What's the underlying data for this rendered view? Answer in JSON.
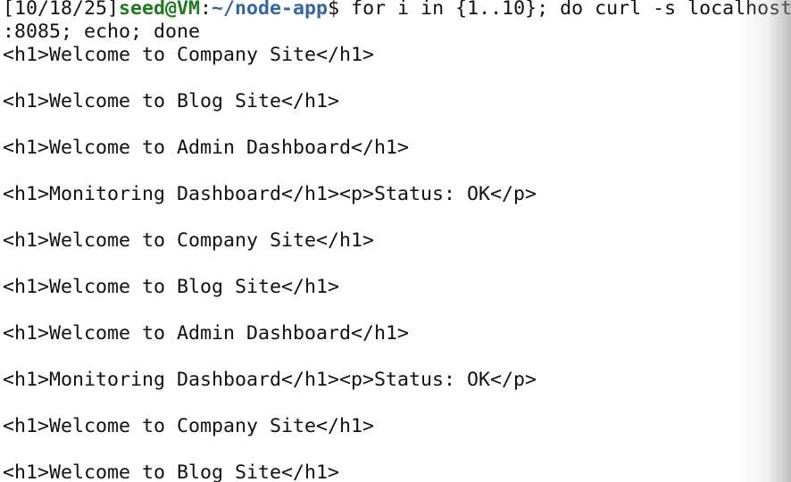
{
  "prompt": {
    "timestamp": "[10/18/25]",
    "user_host": "seed@VM",
    "separator": ":",
    "path": "~/node-app",
    "symbol": "$",
    "command": " for i in {1..10}; do curl -s localhost",
    "command_wrap": ":8085; echo; done"
  },
  "output": [
    "<h1>Welcome to Company Site</h1>",
    "",
    "<h1>Welcome to Blog Site</h1>",
    "",
    "<h1>Welcome to Admin Dashboard</h1>",
    "",
    "<h1>Monitoring Dashboard</h1><p>Status: OK</p>",
    "",
    "<h1>Welcome to Company Site</h1>",
    "",
    "<h1>Welcome to Blog Site</h1>",
    "",
    "<h1>Welcome to Admin Dashboard</h1>",
    "",
    "<h1>Monitoring Dashboard</h1><p>Status: OK</p>",
    "",
    "<h1>Welcome to Company Site</h1>",
    "",
    "<h1>Welcome to Blog Site</h1>"
  ],
  "colors": {
    "background": "#ffffff",
    "text": "#111111",
    "user_host": "#1f7a1f",
    "path": "#3465a4"
  }
}
